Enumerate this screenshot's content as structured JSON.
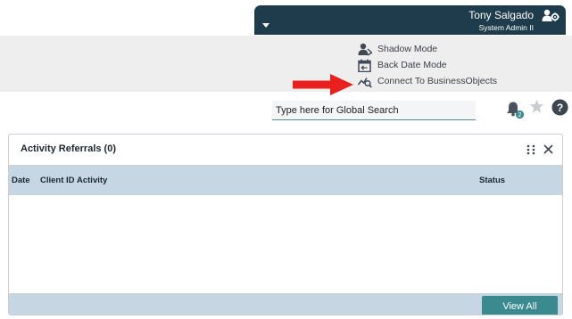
{
  "user": {
    "name": "Tony Salgado",
    "role": "System Admin II"
  },
  "options_menu": {
    "items": [
      {
        "label": "Shadow Mode",
        "icon": "shadow-user-icon"
      },
      {
        "label": "Back Date Mode",
        "icon": "calendar-back-icon"
      },
      {
        "label": "Connect To BusinessObjects",
        "icon": "chart-search-icon"
      }
    ],
    "annotation": "red-arrow-pointing-to-connect"
  },
  "search": {
    "placeholder": "Type here for Global Search"
  },
  "notifications": {
    "badge_count": "2"
  },
  "widget": {
    "title": "Activity Referrals (0)",
    "columns": [
      "Date",
      "Client ID",
      "Activity",
      "Status"
    ],
    "rows": [],
    "view_all_label": "View All"
  },
  "colors": {
    "user_bar": "#1e3c4c",
    "panel_bg": "#eeeeef",
    "table_header": "#c6d6e3",
    "accent_button": "#3a8a90",
    "arrow": "#e8211f"
  }
}
